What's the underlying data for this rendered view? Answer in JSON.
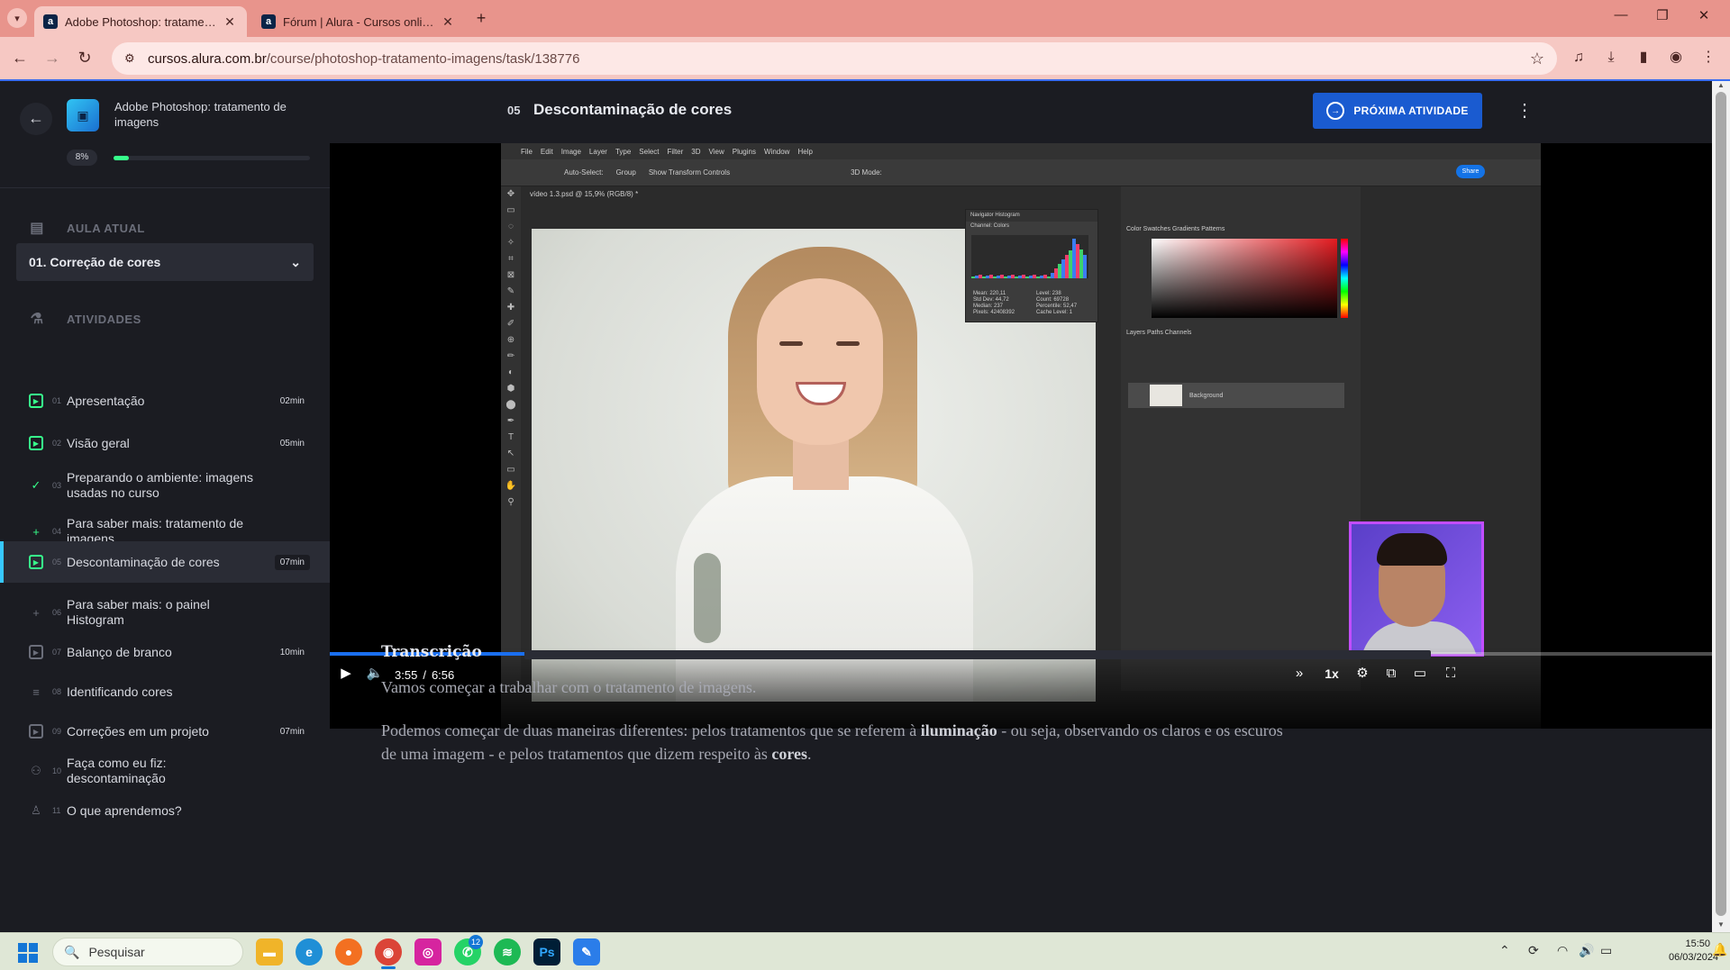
{
  "browser": {
    "tabs": [
      {
        "title": "Adobe Photoshop: tratamento de imagens",
        "favicon": "a",
        "active": true
      },
      {
        "title": "Fórum | Alura - Cursos online de tecnologia",
        "favicon": "a",
        "active": false
      }
    ],
    "url_host": "cursos.alura.com.br",
    "url_path": "/course/photoshop-tratamento-imagens/task/138776"
  },
  "sidebar": {
    "course_title": "Adobe Photoshop: tratamento de imagens",
    "progress_label": "8%",
    "progress_value": 0.08,
    "current_lesson_header": "AULA ATUAL",
    "current_lesson": "01. Correção de cores",
    "activities_header": "ATIVIDADES",
    "activities": [
      {
        "num": "01",
        "title": "Apresentação",
        "duration": "02min",
        "icon": "video-icon",
        "done": true
      },
      {
        "num": "02",
        "title": "Visão geral",
        "duration": "05min",
        "icon": "video-icon",
        "done": true
      },
      {
        "num": "03",
        "title": "Preparando o ambiente: imagens usadas no curso",
        "duration": "",
        "icon": "clipboard-icon",
        "done": true
      },
      {
        "num": "04",
        "title": "Para saber mais: tratamento de imagens",
        "duration": "",
        "icon": "plus-circle-icon",
        "done": true
      },
      {
        "num": "05",
        "title": "Descontaminação de cores",
        "duration": "07min",
        "icon": "video-icon",
        "done": true,
        "current": true
      },
      {
        "num": "06",
        "title": "Para saber mais: o painel Histogram",
        "duration": "",
        "icon": "plus-circle-icon",
        "done": false
      },
      {
        "num": "07",
        "title": "Balanço de branco",
        "duration": "10min",
        "icon": "video-icon",
        "done": false
      },
      {
        "num": "08",
        "title": "Identificando cores",
        "duration": "",
        "icon": "list-icon",
        "done": false
      },
      {
        "num": "09",
        "title": "Correções em um projeto",
        "duration": "07min",
        "icon": "video-icon",
        "done": false
      },
      {
        "num": "10",
        "title": "Faça como eu fiz: descontaminação",
        "duration": "",
        "icon": "people-icon",
        "done": false
      },
      {
        "num": "11",
        "title": "O que aprendemos?",
        "duration": "",
        "icon": "person-icon",
        "done": false
      }
    ]
  },
  "header": {
    "task_number": "05",
    "task_title": "Descontaminação de cores",
    "next_button": "PRÓXIMA ATIVIDADE"
  },
  "player": {
    "current_time": "3:55",
    "separator": "/",
    "duration": "6:56",
    "played_fraction": 0.565,
    "buffered_fraction": 0.58,
    "speed": "1x",
    "photoshop": {
      "menu": [
        "File",
        "Edit",
        "Image",
        "Layer",
        "Type",
        "Select",
        "Filter",
        "3D",
        "View",
        "Plugins",
        "Window",
        "Help"
      ],
      "options": [
        "Auto-Select:",
        "Group",
        "Show Transform Controls",
        "3D Mode:"
      ],
      "share": "Share",
      "doc_tab": "vídeo 1.3.psd @ 15,9% (RGB/8) *",
      "histogram_tabs": "Navigator   Histogram",
      "histogram_channel": "Channel:  Colors",
      "histogram_stats": [
        "Mean: 220,11",
        "Std Dev: 44,72",
        "Median: 237",
        "Pixels: 42408392",
        "Level: 238",
        "Count: 69728",
        "Percentile: 52,47",
        "Cache Level: 1"
      ],
      "color_tabs": "Color   Swatches   Gradients   Patterns",
      "layers_tabs": "Layers   Paths   Channels",
      "layer_name": "Background"
    }
  },
  "transcript": {
    "heading": "Transcrição",
    "p1": "Vamos começar a trabalhar com o tratamento de imagens.",
    "p2_a": "Podemos começar de duas maneiras diferentes: pelos tratamentos que se referem à ",
    "p2_b": "iluminação",
    "p2_c": " - ou seja, observando os claros e os escuros de uma imagem - e pelos tratamentos que dizem respeito às ",
    "p2_d": "cores",
    "p2_e": "."
  },
  "taskbar": {
    "search_placeholder": "Pesquisar",
    "whatsapp_badge": "12",
    "time": "15:50",
    "date": "06/03/2024"
  },
  "colors": {
    "accent_green": "#37ff8b",
    "accent_blue": "#1a5bd0",
    "browser_chrome": "#e8948c"
  }
}
